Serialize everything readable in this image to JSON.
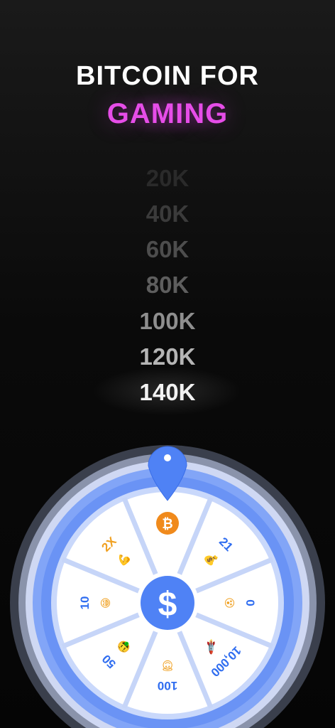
{
  "header": {
    "line1": "BITCOIN FOR",
    "line2": "GAMING"
  },
  "amounts": [
    "20K",
    "40K",
    "60K",
    "80K",
    "100K",
    "120K",
    "140K"
  ],
  "wheel": {
    "center_symbol": "$",
    "segments": [
      {
        "label": "",
        "icon": "bitcoin-icon",
        "glyph": "₿"
      },
      {
        "label": "21",
        "icon": "money-bag-icon",
        "glyph": "💰"
      },
      {
        "label": "0",
        "icon": "dizzy-face-icon",
        "glyph": "😵"
      },
      {
        "label": "10,000",
        "icon": "rocket-icon",
        "glyph": "🚀"
      },
      {
        "label": "100",
        "icon": "halo-face-icon",
        "glyph": "😇"
      },
      {
        "label": "50",
        "icon": "money-face-icon",
        "glyph": "🤑"
      },
      {
        "label": "10",
        "icon": "grin-face-icon",
        "glyph": "😁"
      },
      {
        "label": "2X",
        "icon": "flexed-arm-icon",
        "glyph": "💪"
      }
    ]
  },
  "colors": {
    "accent_pink": "#e64de8",
    "wheel_blue": "#4f82f5",
    "wheel_label_blue": "#2f6df0",
    "bitcoin_orange": "#f08a1c",
    "gold": "#f0a020"
  }
}
